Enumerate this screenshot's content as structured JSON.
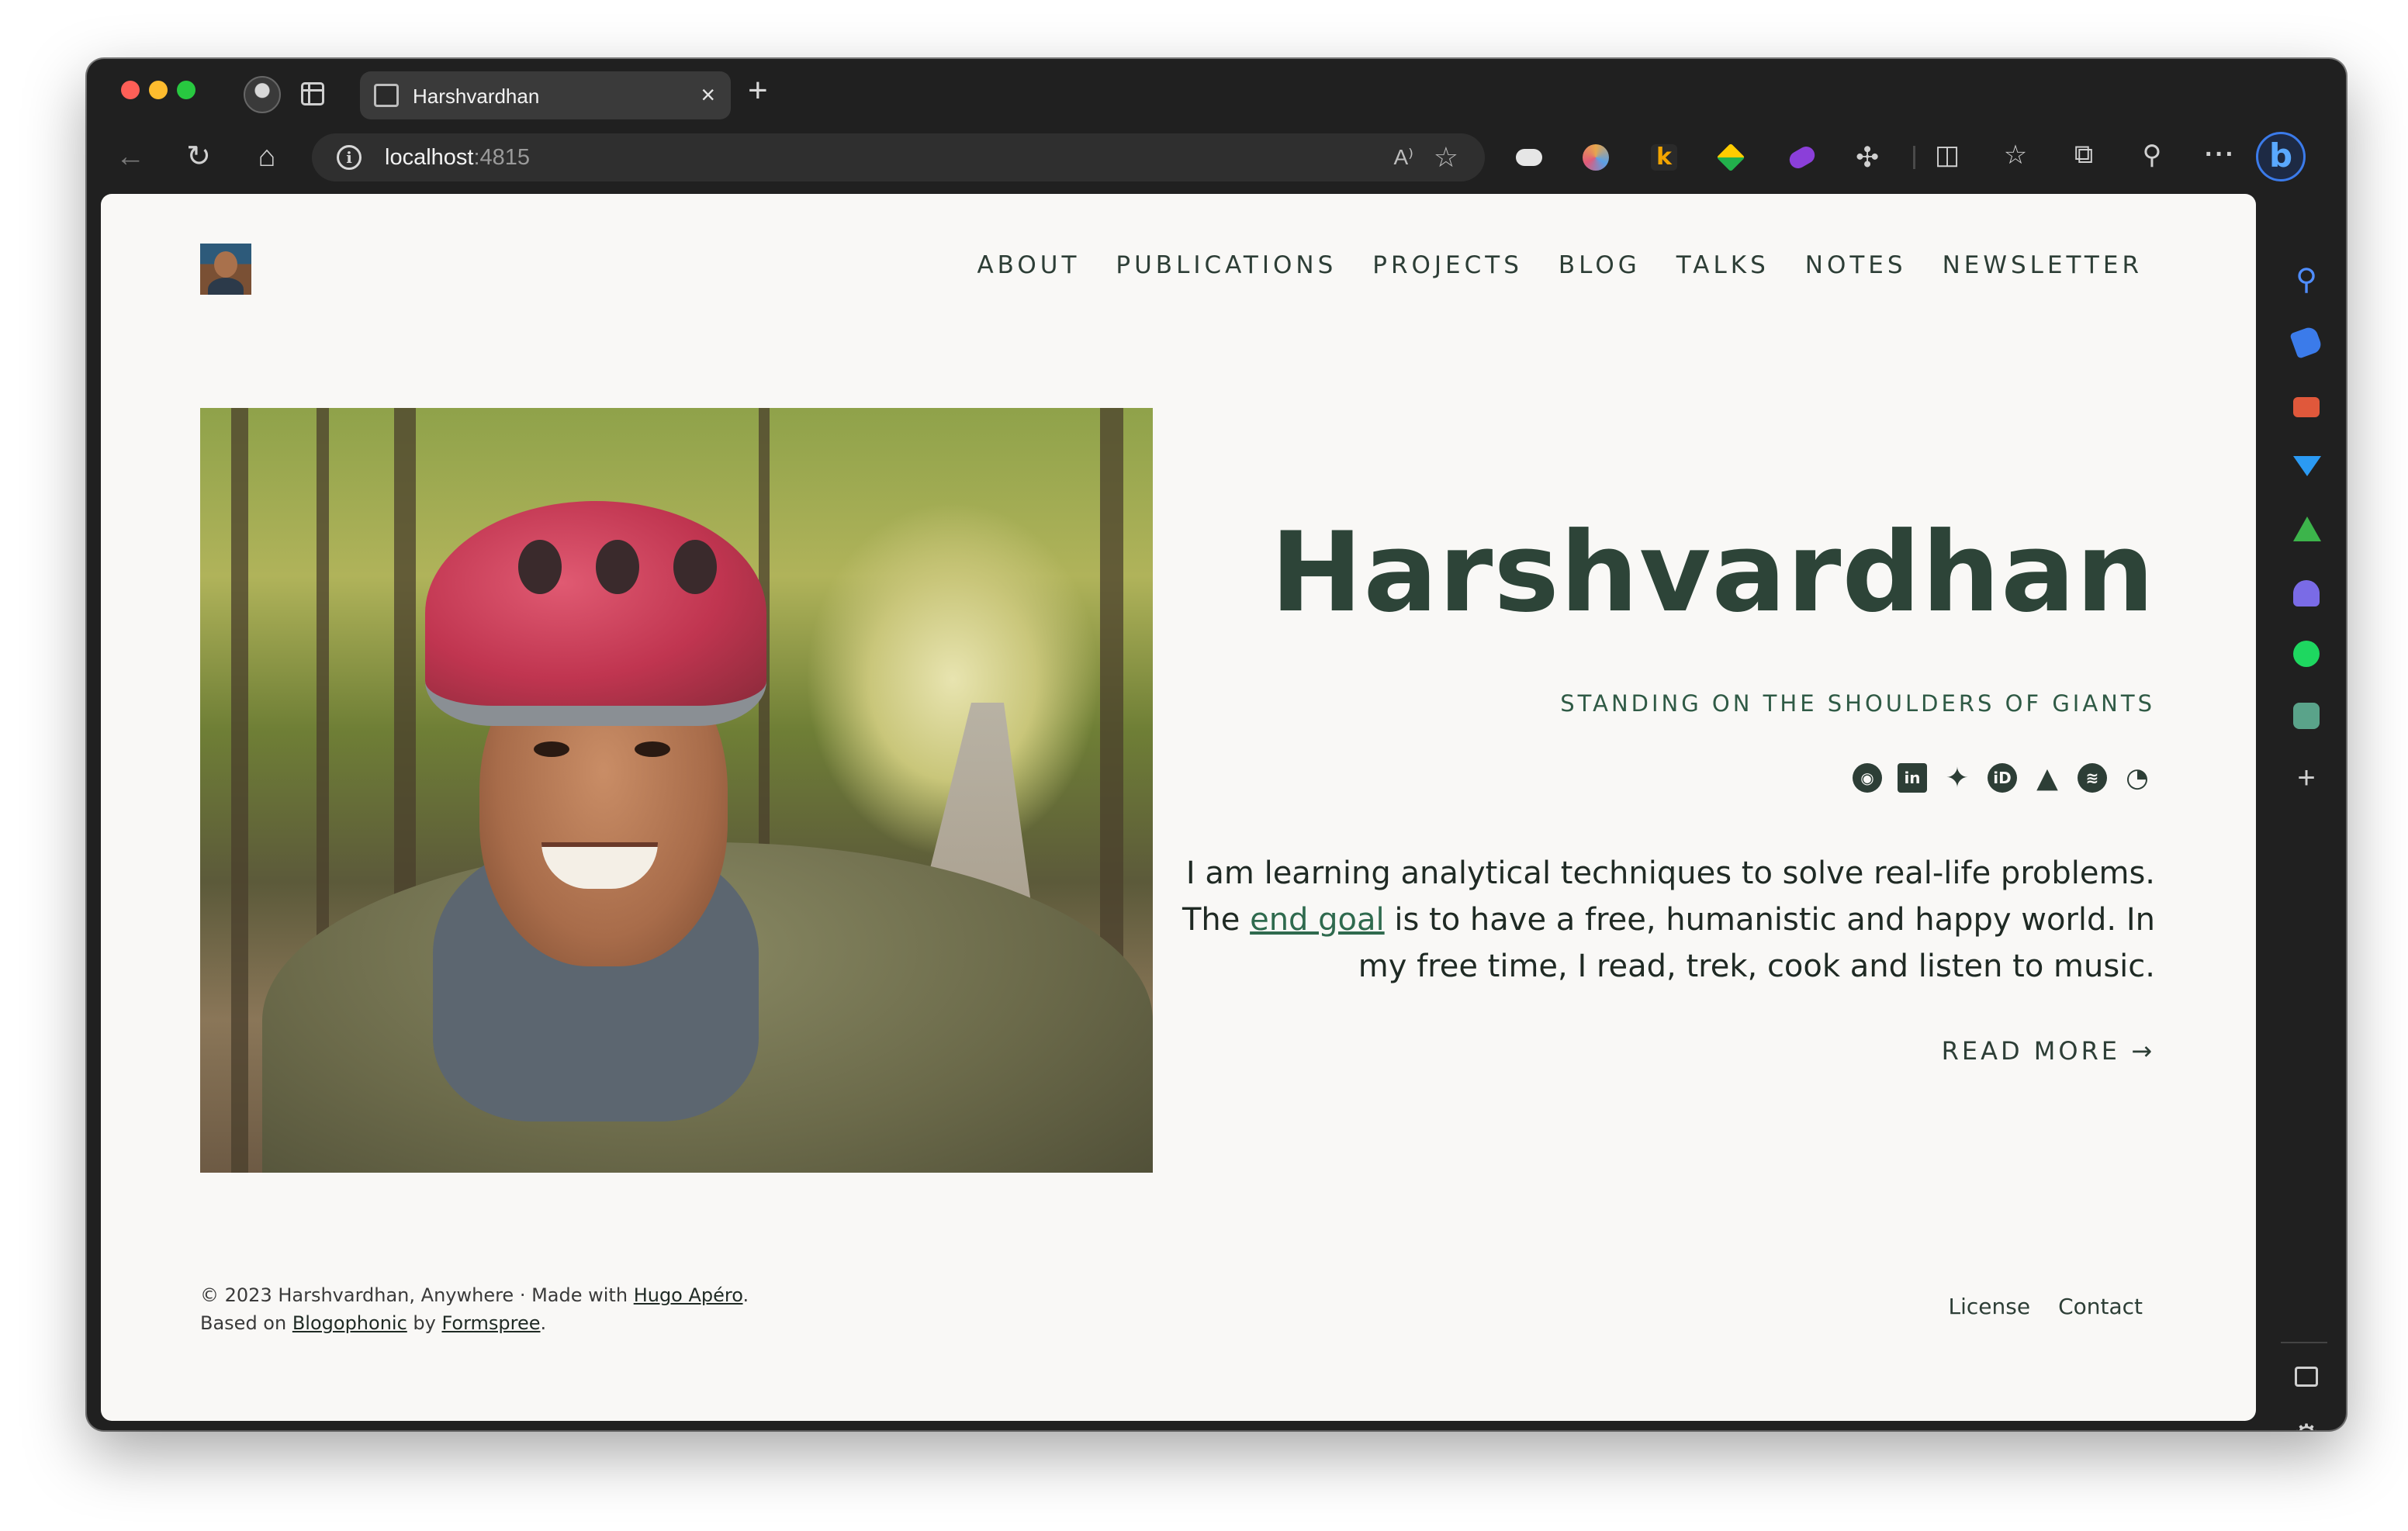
{
  "browser": {
    "tab": {
      "title": "Harshvardhan",
      "close": "×"
    },
    "new_tab": "+",
    "address": {
      "host": "localhost",
      "port": ":4815"
    },
    "nav": {
      "back": "←",
      "reload": "↻",
      "home": "⌂"
    },
    "toolbar_icons": {
      "read_aloud": "A⁾",
      "favorite": "☆",
      "extensions": "⚙",
      "split": "◫",
      "favorites": "☆",
      "collections": "⧉",
      "share": "⚲",
      "more": "···",
      "bing": "b"
    },
    "sidebar": {
      "search": "⚲",
      "add": "+",
      "settings": "⚙"
    },
    "ext_k": "k"
  },
  "site": {
    "nav": [
      "ABOUT",
      "PUBLICATIONS",
      "PROJECTS",
      "BLOG",
      "TALKS",
      "NOTES",
      "NEWSLETTER"
    ],
    "hero": {
      "title": "Harshvardhan",
      "subtitle": "STANDING ON THE SHOULDERS OF GIANTS",
      "desc_part1": "I am learning analytical techniques to solve real-life problems. The ",
      "desc_link": "end goal",
      "desc_part2": " is to have a free, humanistic and happy world. In my free time, I read, trek, cook and listen to music.",
      "read_more": "READ MORE →"
    },
    "social_icons": [
      "github-icon",
      "linkedin-icon",
      "twitter-icon",
      "orcid-icon",
      "scholar-icon",
      "spotify-icon",
      "rss-icon"
    ],
    "social_glyphs": {
      "github": "◉",
      "linkedin": "in",
      "twitter": "🐦",
      "orcid": "iD",
      "scholar": "🎓",
      "spotify": "≋",
      "rss": "◠"
    },
    "footer": {
      "copyright": "© 2023 Harshvardhan, Anywhere",
      "sep": " · ",
      "made_with": "Made with ",
      "hugo": "Hugo Apéro",
      "period": ".",
      "based_on": "Based on ",
      "blogophonic": "Blogophonic",
      "by": " by ",
      "formspree": "Formspree",
      "period2": ".",
      "license": "License",
      "contact": "Contact"
    }
  }
}
